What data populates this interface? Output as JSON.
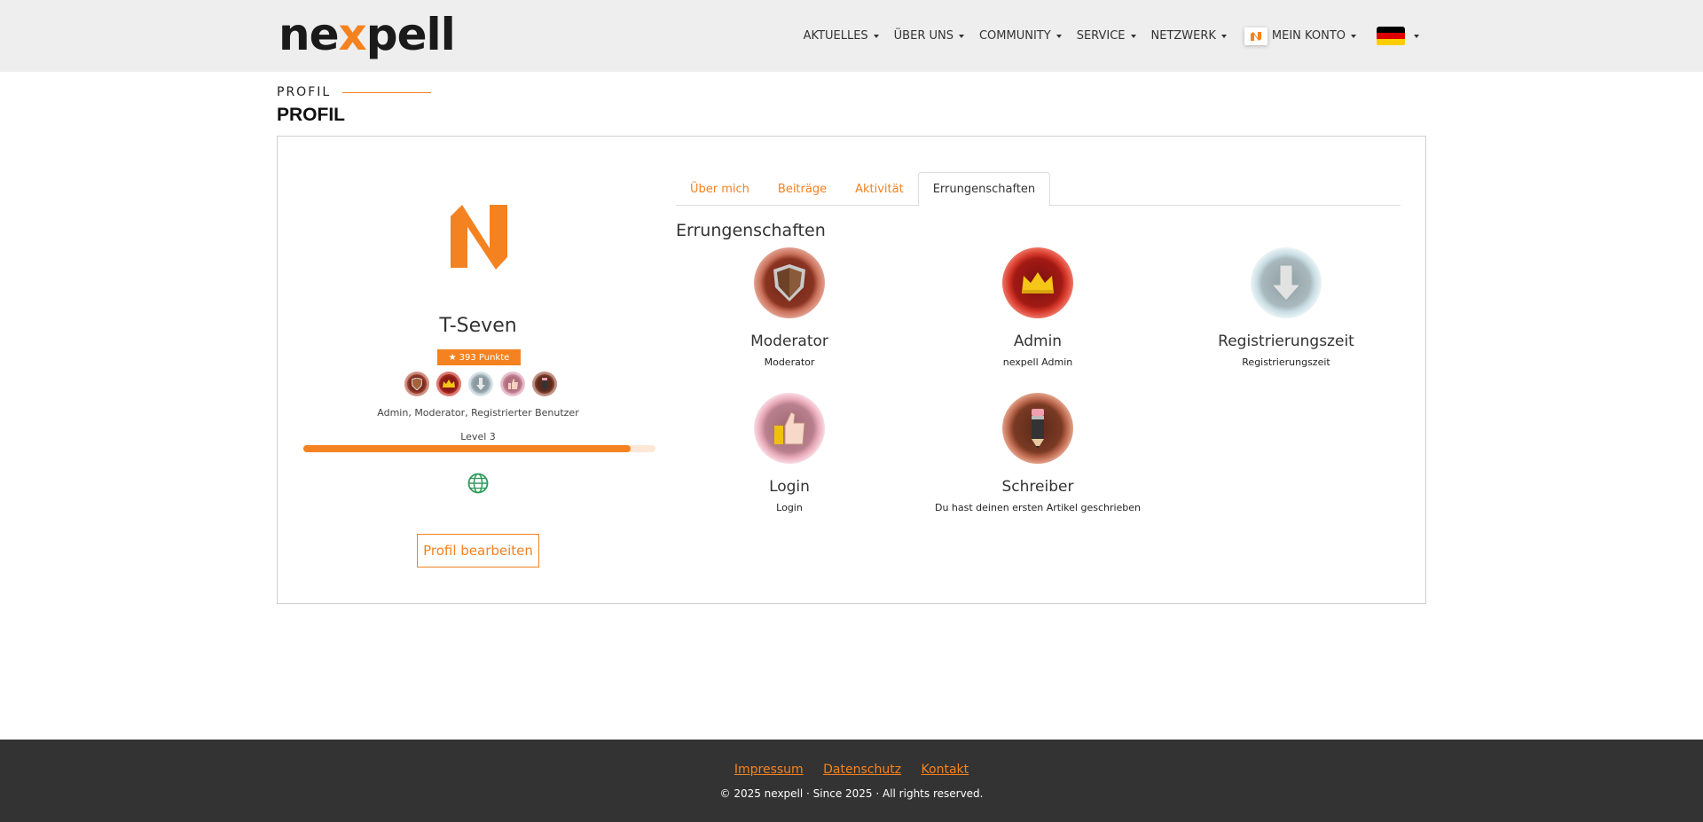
{
  "header": {
    "logo_left": "ne",
    "logo_x": "x",
    "logo_right": "pell",
    "nav": [
      {
        "label": "AKTUELLES"
      },
      {
        "label": "ÜBER UNS"
      },
      {
        "label": "COMMUNITY"
      },
      {
        "label": "SERVICE"
      },
      {
        "label": "NETZWERK"
      },
      {
        "label": "MEIN KONTO"
      }
    ],
    "language_flag": "de-flag-icon",
    "accent_color": "#f58220"
  },
  "page": {
    "breadcrumb": "PROFIL",
    "title": "PROFIL"
  },
  "profile": {
    "username": "T-Seven",
    "points": "393 Punkte",
    "roles": "Admin, Moderator, Registrierter Benutzer",
    "level": "Level 3",
    "level_progress": 0.93,
    "mini_badges": [
      "moderator-badge-icon",
      "admin-badge-icon",
      "registration-badge-icon",
      "login-badge-icon",
      "writer-badge-icon"
    ],
    "website_icon": "globe-icon",
    "edit_button": "Profil bearbeiten"
  },
  "tabs": [
    {
      "label": "Über mich",
      "active": false
    },
    {
      "label": "Beiträge",
      "active": false
    },
    {
      "label": "Aktivität",
      "active": false
    },
    {
      "label": "Errungenschaften",
      "active": true
    }
  ],
  "achievements": {
    "title": "Errungenschaften",
    "items": [
      {
        "name": "Moderator",
        "description": "Moderator",
        "icon": "shield-icon"
      },
      {
        "name": "Admin",
        "description": "nexpell Admin",
        "icon": "crown-icon"
      },
      {
        "name": "Registrierungszeit",
        "description": "Registrierungszeit",
        "icon": "download-arrow-icon"
      },
      {
        "name": "Login",
        "description": "Login",
        "icon": "thumbs-up-icon"
      },
      {
        "name": "Schreiber",
        "description": "Du hast deinen ersten Artikel geschrieben",
        "icon": "pencil-icon"
      }
    ]
  },
  "footer": {
    "links": [
      "Impressum",
      "Datenschutz",
      "Kontakt"
    ],
    "copyright": "© 2025 nexpell · Since 2025 · All rights reserved."
  }
}
